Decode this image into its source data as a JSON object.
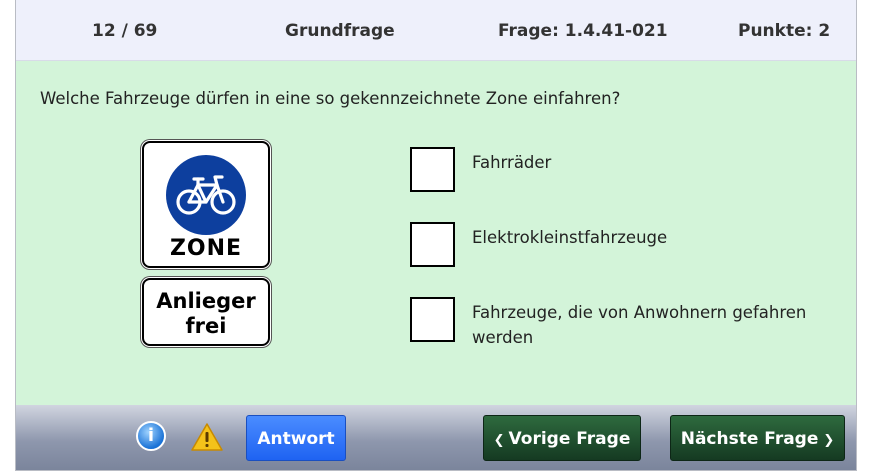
{
  "header": {
    "progress": "12 / 69",
    "category": "Grundfrage",
    "question_id": "Frage: 1.4.41-021",
    "points": "Punkte: 2"
  },
  "question": {
    "text": "Welche Fahrzeuge dürfen in eine so gekennzeichnete Zone einfahren?"
  },
  "signs": {
    "zone_label": "ZONE",
    "extra_line1": "Anlieger",
    "extra_line2": "frei"
  },
  "options": [
    {
      "label": "Fahrräder",
      "checked": false
    },
    {
      "label": "Elektrokleinstfahrzeuge",
      "checked": false
    },
    {
      "label": "Fahrzeuge, die von Anwohnern gefahren werden",
      "checked": false
    }
  ],
  "footer": {
    "info_icon_glyph": "i",
    "answer_button": "Antwort",
    "prev_button": "Vorige Frage",
    "next_button": "Nächste Frage",
    "prev_chevron": "❮",
    "next_chevron": "❯"
  },
  "colors": {
    "content_bg": "#d3f4d9",
    "header_bg": "#eef0fb",
    "sign_blue": "#0d3f9e",
    "answer_button": "#2a72f8",
    "nav_button": "#1f4d2d"
  },
  "icons": {
    "info": "info-icon",
    "warning": "warning-triangle-icon",
    "bicycle": "bicycle-icon"
  }
}
